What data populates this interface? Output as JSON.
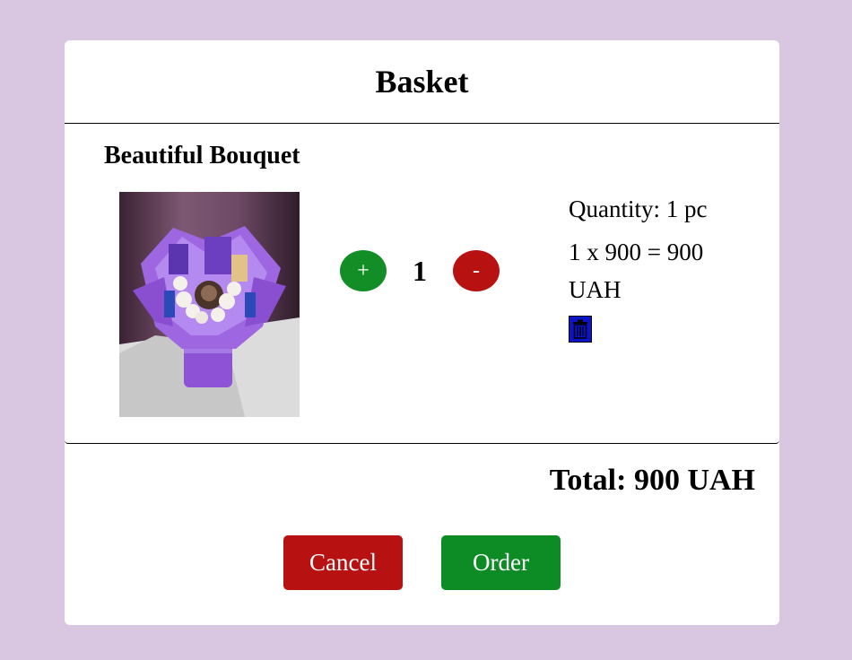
{
  "modal": {
    "title": "Basket"
  },
  "item": {
    "name": "Beautiful Bouquet",
    "image_alt": "bouquet-photo",
    "plus_label": "+",
    "minus_label": "-",
    "count": "1",
    "quantity_text": "Quantity: 1 pc",
    "price_text": "1 x 900 = 900 UAH",
    "delete_icon": "trash-icon"
  },
  "total": {
    "text": "Total: 900 UAH"
  },
  "buttons": {
    "cancel": "Cancel",
    "order": "Order"
  },
  "colors": {
    "background": "#d9c6e1",
    "green": "#138d25",
    "red": "#b71111",
    "trash_blue": "#0b14c8"
  }
}
